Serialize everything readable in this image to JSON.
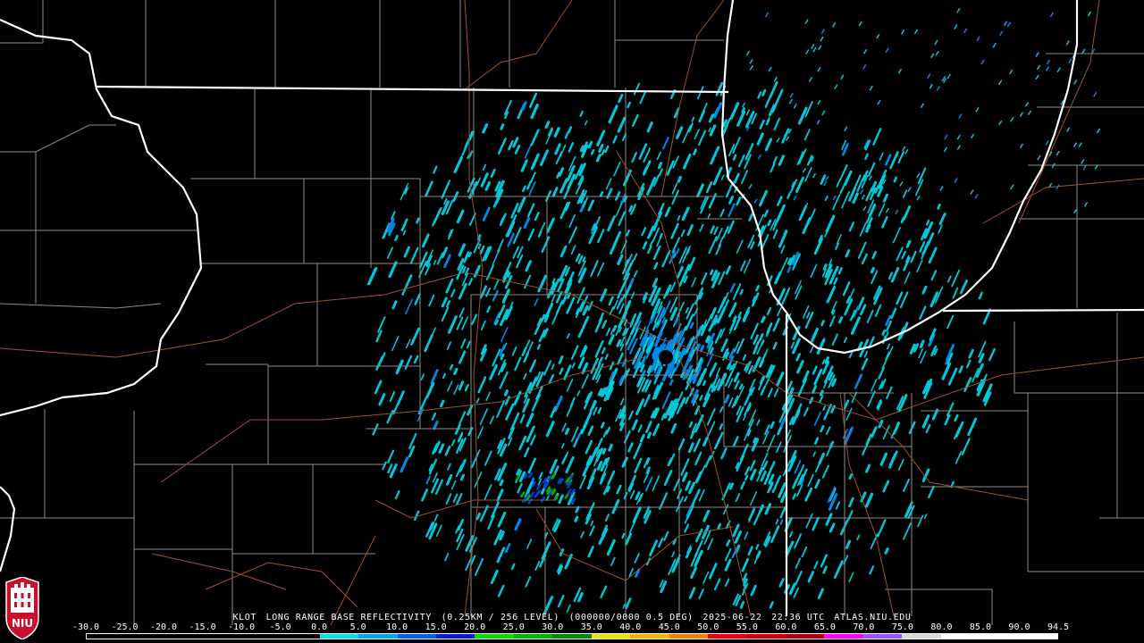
{
  "caption": {
    "station": "KLOT",
    "product": "LONG RANGE BASE REFLECTIVITY",
    "resolution": "(0.25KM / 256 LEVEL)",
    "scan": "(000000/0000 0.5 DEG)",
    "date": "2025-06-22",
    "time": "22:36 UTC",
    "source": "ATLAS.NIU.EDU"
  },
  "logo": {
    "text": "NIU",
    "color": "#c8102e",
    "icon": "niu-castle-icon"
  },
  "colorbar": {
    "ticks": [
      "-30.0",
      "-25.0",
      "-20.0",
      "-15.0",
      "-10.0",
      "-5.0",
      "0.0",
      "5.0",
      "10.0",
      "15.0",
      "20.0",
      "25.0",
      "30.0",
      "35.0",
      "40.0",
      "45.0",
      "50.0",
      "55.0",
      "60.0",
      "65.0",
      "70.0",
      "75.0",
      "80.0",
      "85.0",
      "90.0",
      "94.5"
    ],
    "colors": [
      "#000000",
      "#000000",
      "#000000",
      "#000000",
      "#000000",
      "#000000",
      "#00e0e0",
      "#00a8f0",
      "#0060f0",
      "#0020d8",
      "#00e000",
      "#00b400",
      "#008800",
      "#f0e000",
      "#f0b400",
      "#f08000",
      "#f00000",
      "#d00000",
      "#b00000",
      "#ff00ff",
      "#a050ff",
      "#d8d8d8",
      "#ffffff",
      "#ffffff",
      "#ffffff"
    ]
  },
  "map": {
    "state_border_color": "#ffffff",
    "county_line_color": "#8c8c8c",
    "road_color": "#a0522d",
    "echo_colors": {
      "light": "#00c8d8",
      "medium": "#0088e8",
      "heavy": "#0040d0",
      "strong": "#00b000"
    }
  }
}
